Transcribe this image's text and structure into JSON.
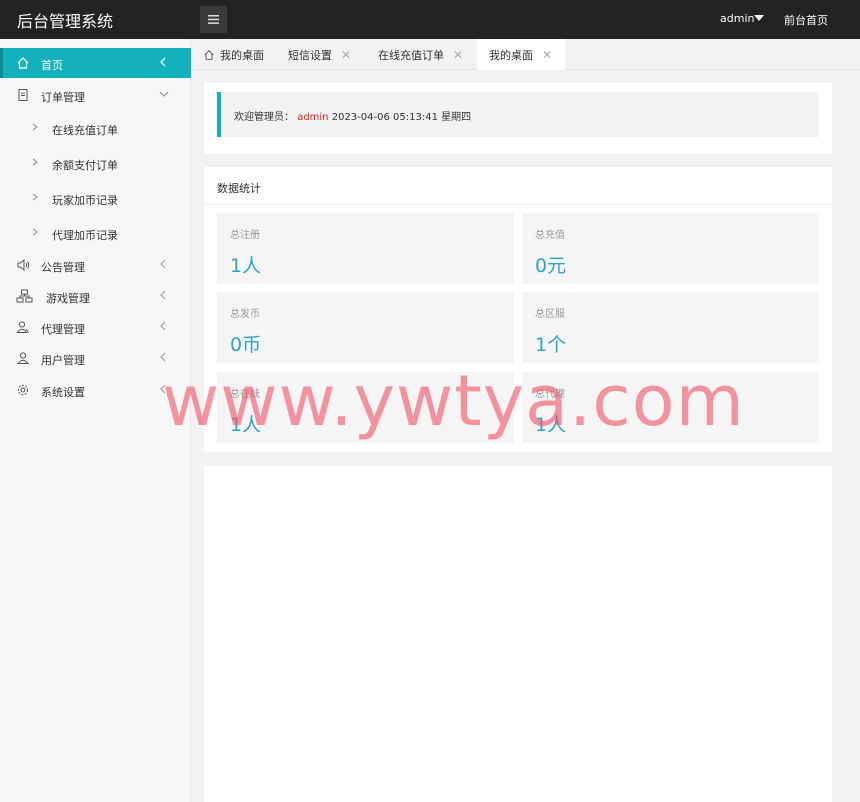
{
  "header": {
    "title": "后台管理系统",
    "user": "admin",
    "front_link": "前台首页"
  },
  "sidebar": {
    "items": [
      {
        "label": "首页",
        "icon": "home-icon",
        "active": true
      },
      {
        "label": "订单管理",
        "icon": "document-icon",
        "expanded": true,
        "children": [
          "在线充值订单",
          "余额支付订单",
          "玩家加币记录",
          "代理加币记录"
        ]
      },
      {
        "label": "公告管理",
        "icon": "speaker-icon"
      },
      {
        "label": "游戏管理",
        "icon": "sitemap-icon"
      },
      {
        "label": "代理管理",
        "icon": "user-group-icon"
      },
      {
        "label": "用户管理",
        "icon": "user-icon"
      },
      {
        "label": "系统设置",
        "icon": "gear-icon"
      }
    ]
  },
  "tabs": [
    {
      "label": "我的桌面",
      "closable": false
    },
    {
      "label": "短信设置",
      "closable": true
    },
    {
      "label": "在线充值订单",
      "closable": true
    },
    {
      "label": "我的桌面",
      "closable": true,
      "active": true
    }
  ],
  "tab_close_glyph": "✕",
  "welcome": {
    "prefix": "欢迎管理员：",
    "user": "admin",
    "datetime": "2023-04-06  05:13:41  星期四"
  },
  "stats": {
    "title": "数据统计",
    "boxes": [
      {
        "label": "总注册",
        "value": "1人"
      },
      {
        "label": "总充值",
        "value": "0元"
      },
      {
        "label": "总发币",
        "value": "0币"
      },
      {
        "label": "总区服",
        "value": "1个"
      },
      {
        "label": "总在线",
        "value": "1人"
      },
      {
        "label": "总代理",
        "value": "1人"
      }
    ]
  },
  "watermark": "www.ywtya.com",
  "colors": {
    "accent": "#12b1bb",
    "header_bg": "#232323",
    "stat_value": "#2fa4c6",
    "welcome_user": "#e02020"
  }
}
